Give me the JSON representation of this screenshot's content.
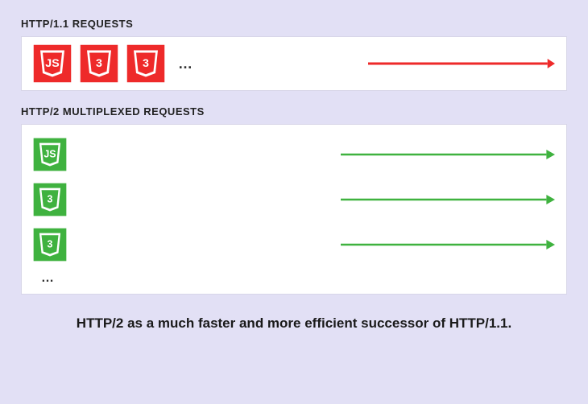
{
  "http1": {
    "title": "HTTP/1.1 REQUESTS",
    "icons": [
      "JS",
      "3",
      "3"
    ],
    "ellipsis": "…",
    "arrow_color": "#EE2A2A",
    "badge_color": "#EE2A2A"
  },
  "http2": {
    "title": "HTTP/2 MULTIPLEXED REQUESTS",
    "rows": [
      {
        "icon": "JS"
      },
      {
        "icon": "3"
      },
      {
        "icon": "3"
      }
    ],
    "ellipsis": "…",
    "arrow_color": "#3FB23F",
    "badge_color": "#3FB23F"
  },
  "caption": "HTTP/2 as a much faster and more efficient successor of HTTP/1.1."
}
